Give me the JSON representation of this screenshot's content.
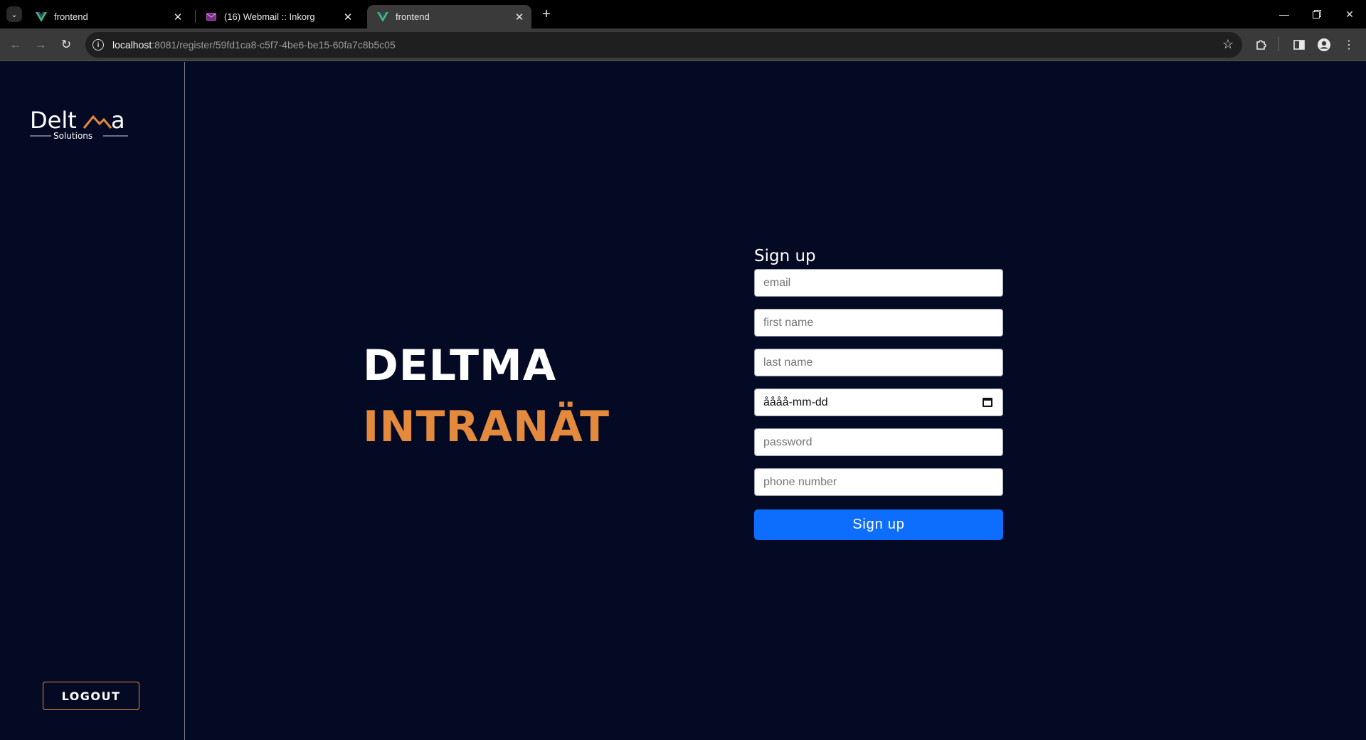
{
  "browser": {
    "tabs": [
      {
        "title": "frontend",
        "favicon": "vue-icon"
      },
      {
        "title": "(16) Webmail :: Inkorg",
        "favicon": "mail-icon"
      },
      {
        "title": "frontend",
        "favicon": "vue-icon",
        "active": true
      }
    ],
    "url_host": "localhost",
    "url_path": ":8081/register/59fd1ca8-c5f7-4be6-be15-60fa7c8b5c05"
  },
  "sidebar": {
    "logo_text": "Deltma",
    "logo_sub": "Solutions",
    "logout_label": "LOGOUT"
  },
  "hero": {
    "line1": "DELTMA",
    "line2": "INTRANÄT"
  },
  "form": {
    "title": "Sign up",
    "email_placeholder": "email",
    "first_name_placeholder": "first name",
    "last_name_placeholder": "last name",
    "date_value": "åååå-mm-dd",
    "password_placeholder": "password",
    "phone_placeholder": "phone number",
    "submit_label": "Sign up"
  },
  "colors": {
    "background": "#040a24",
    "accent": "#e38a3d",
    "primary_button": "#0d6efd"
  }
}
